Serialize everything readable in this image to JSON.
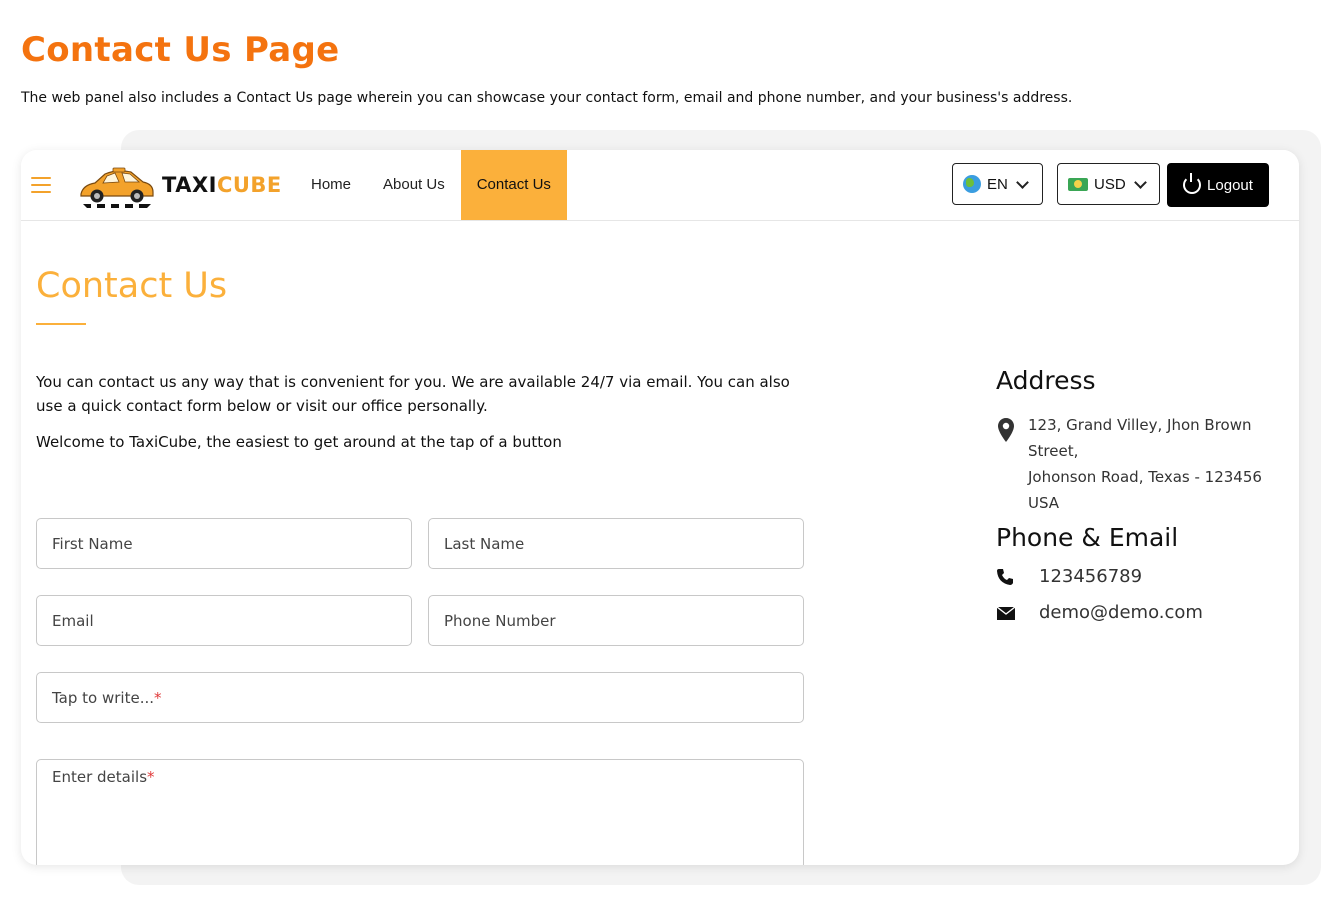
{
  "page": {
    "title": "Contact Us Page",
    "description": "The web panel also includes a Contact Us page wherein you can showcase your contact form, email and phone number, and your business's address."
  },
  "brand": {
    "part1": "TAXI",
    "part2": "CUBE",
    "accent": "#fbb03b",
    "title_color": "#f4730f"
  },
  "nav": {
    "items": [
      {
        "label": "Home",
        "active": false
      },
      {
        "label": "About Us",
        "active": false
      },
      {
        "label": "Contact Us",
        "active": true
      }
    ],
    "language": {
      "label": "EN",
      "icon": "globe-icon"
    },
    "currency": {
      "label": "USD",
      "icon": "money-icon"
    },
    "logout": {
      "label": "Logout",
      "icon": "power-icon"
    }
  },
  "contact": {
    "title": "Contact Us",
    "intro": "You can contact us any way that is convenient for you. We are available 24/7 via email. You can also use a quick contact form below or visit our office personally.",
    "welcome": "Welcome to TaxiCube, the easiest to get around at the tap of a button",
    "form": {
      "first_name_placeholder": "First Name",
      "last_name_placeholder": "Last Name",
      "email_placeholder": "Email",
      "phone_placeholder": "Phone Number",
      "subject_placeholder": "Tap to write...",
      "details_placeholder": "Enter details",
      "required_mark": "*"
    }
  },
  "sidebar": {
    "address_heading": "Address",
    "address_lines": [
      "123, Grand Villey, Jhon Brown Street,",
      "Johonson Road, Texas - 123456",
      "USA"
    ],
    "phone_email_heading": "Phone & Email",
    "phone": "123456789",
    "email": "demo@demo.com"
  }
}
